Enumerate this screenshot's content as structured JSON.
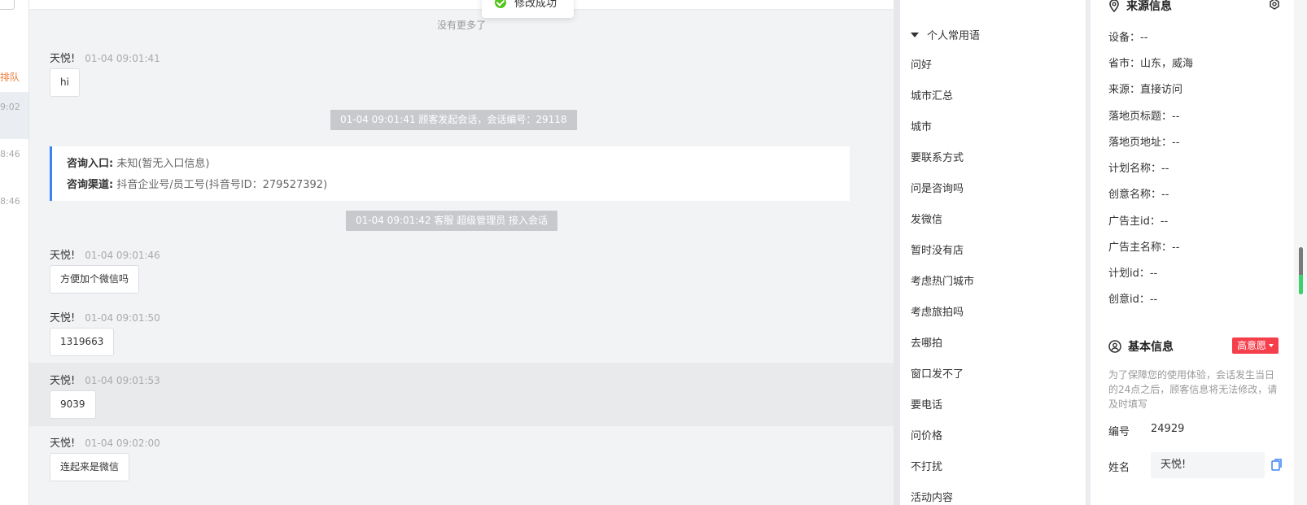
{
  "left": {
    "queue_label": "排队",
    "times": [
      "9:02",
      "8:46",
      "8:46"
    ]
  },
  "chat": {
    "no_more": "没有更多了",
    "messages": [
      {
        "sender": "天悦!",
        "time": "01-04 09:01:41",
        "text": "hi"
      },
      {
        "sender": "天悦!",
        "time": "01-04 09:01:46",
        "text": "方便加个微信吗"
      },
      {
        "sender": "天悦!",
        "time": "01-04 09:01:50",
        "text": "1319663"
      },
      {
        "sender": "天悦!",
        "time": "01-04 09:01:53",
        "text": "9039"
      },
      {
        "sender": "天悦!",
        "time": "01-04 09:02:00",
        "text": "连起来是微信"
      }
    ],
    "system_notes": [
      "01-04 09:01:41 顾客发起会话，会话编号：29118",
      "01-04 09:01:42 客服 超级管理员 接入会话"
    ],
    "entry_card": {
      "entry_label": "咨询入口:",
      "entry_value": "未知(暂无入口信息)",
      "channel_label": "咨询渠道:",
      "channel_value": "抖音企业号/员工号(抖音号ID：279527392)"
    }
  },
  "toast": {
    "text": "修改成功"
  },
  "phrases": {
    "header": "个人常用语",
    "items": [
      "问好",
      "城市汇总",
      "城市",
      "要联系方式",
      "问是咨询吗",
      "发微信",
      "暂时没有店",
      "考虑热门城市",
      "考虑旅拍吗",
      "去哪拍",
      "窗口发不了",
      "要电话",
      "问价格",
      "不打扰",
      "活动内容"
    ]
  },
  "info": {
    "source_title": "来源信息",
    "source_fields": [
      "设备：--",
      "省市：山东，威海",
      "来源：直接访问",
      "落地页标题：--",
      "落地页地址：--",
      "计划名称：--",
      "创意名称：--",
      "广告主id：--",
      "广告主名称：--",
      "计划id：--",
      "创意id：--"
    ],
    "basic_title": "基本信息",
    "intent_badge": "高意愿",
    "notice": "为了保障您的使用体验，会话发生当日的24点之后，顾客信息将无法修改，请及时填写",
    "id_label": "编号",
    "id_value": "24929",
    "name_label": "姓名",
    "name_value": "天悦!"
  },
  "colors": {
    "accent": "#3b82f6",
    "badge": "#f5404c",
    "success": "#52c41a",
    "queue": "#f07c3c"
  }
}
